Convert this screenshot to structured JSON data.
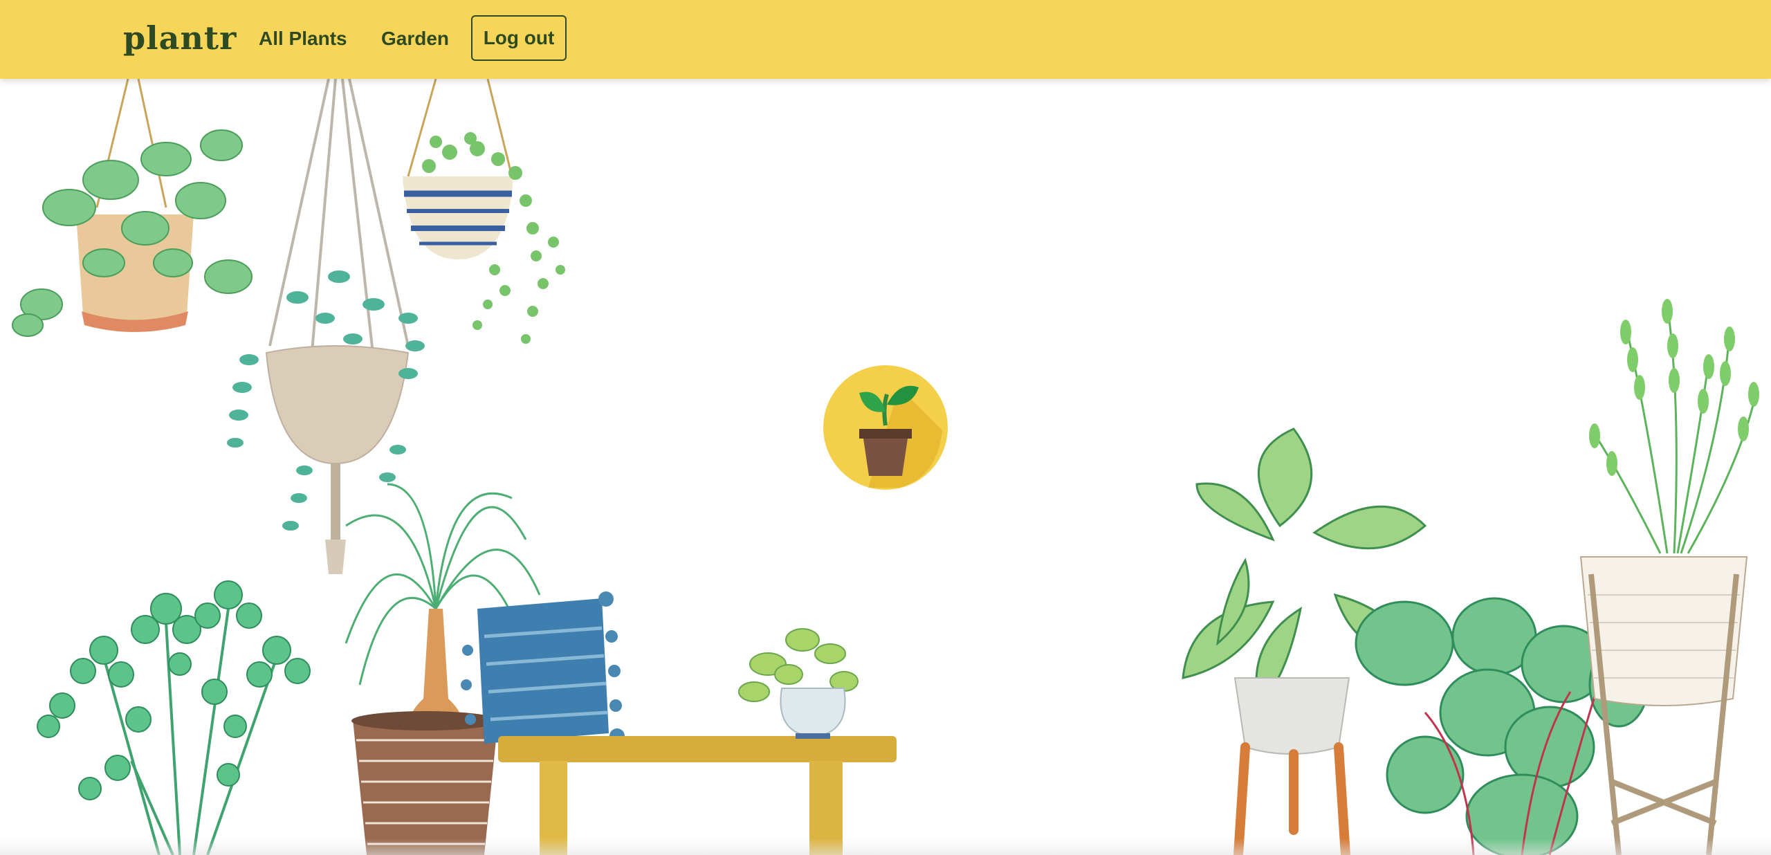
{
  "navbar": {
    "brand": "plantr",
    "links": [
      {
        "label": "All Plants"
      },
      {
        "label": "Garden"
      }
    ],
    "logout_label": "Log out"
  },
  "colors": {
    "navbar_bg": "#f7d558",
    "nav_text": "#2d4a22",
    "logo_circle": "#f4cf4a"
  },
  "icons": {
    "center_logo": "potted-sprout-icon"
  }
}
